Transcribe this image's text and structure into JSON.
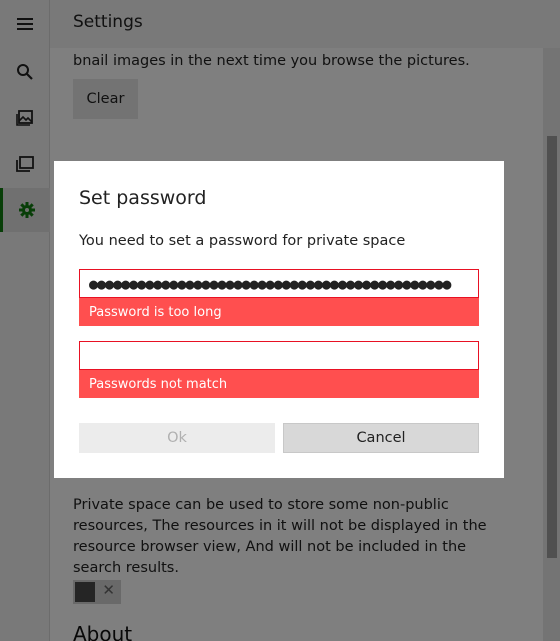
{
  "window": {
    "title": "Settings"
  },
  "nav": {
    "items": [
      {
        "name": "menu",
        "icon": "hamburger-menu-icon"
      },
      {
        "name": "search",
        "icon": "search-icon"
      },
      {
        "name": "pictures",
        "icon": "picture-icon"
      },
      {
        "name": "collections",
        "icon": "folders-icon"
      },
      {
        "name": "settings",
        "icon": "gear-icon",
        "active": true
      }
    ]
  },
  "content": {
    "thumbnail_text": "bnail images in the next time you browse the pictures.",
    "clear_label": "Clear",
    "private_space_text": "Private space can be used to store some non-public resources, The resources in it will not be displayed in the resource browser view, And will not be included in the search results.",
    "about_heading": "About",
    "private_toggle": {
      "state": "off",
      "off_glyph": "✕"
    }
  },
  "dialog": {
    "title": "Set password",
    "description": "You need to set a password for private space",
    "password_value": "●●●●●●●●●●●●●●●●●●●●●●●●●●●●●●●●●●●●●●●●●●●●●",
    "password_error": "Password is too long",
    "confirm_value": "",
    "confirm_error": "Passwords not match",
    "ok_label": "Ok",
    "cancel_label": "Cancel"
  },
  "colors": {
    "accent": "#107c10",
    "error": "#ff4f4f",
    "error_border": "#e81123"
  }
}
